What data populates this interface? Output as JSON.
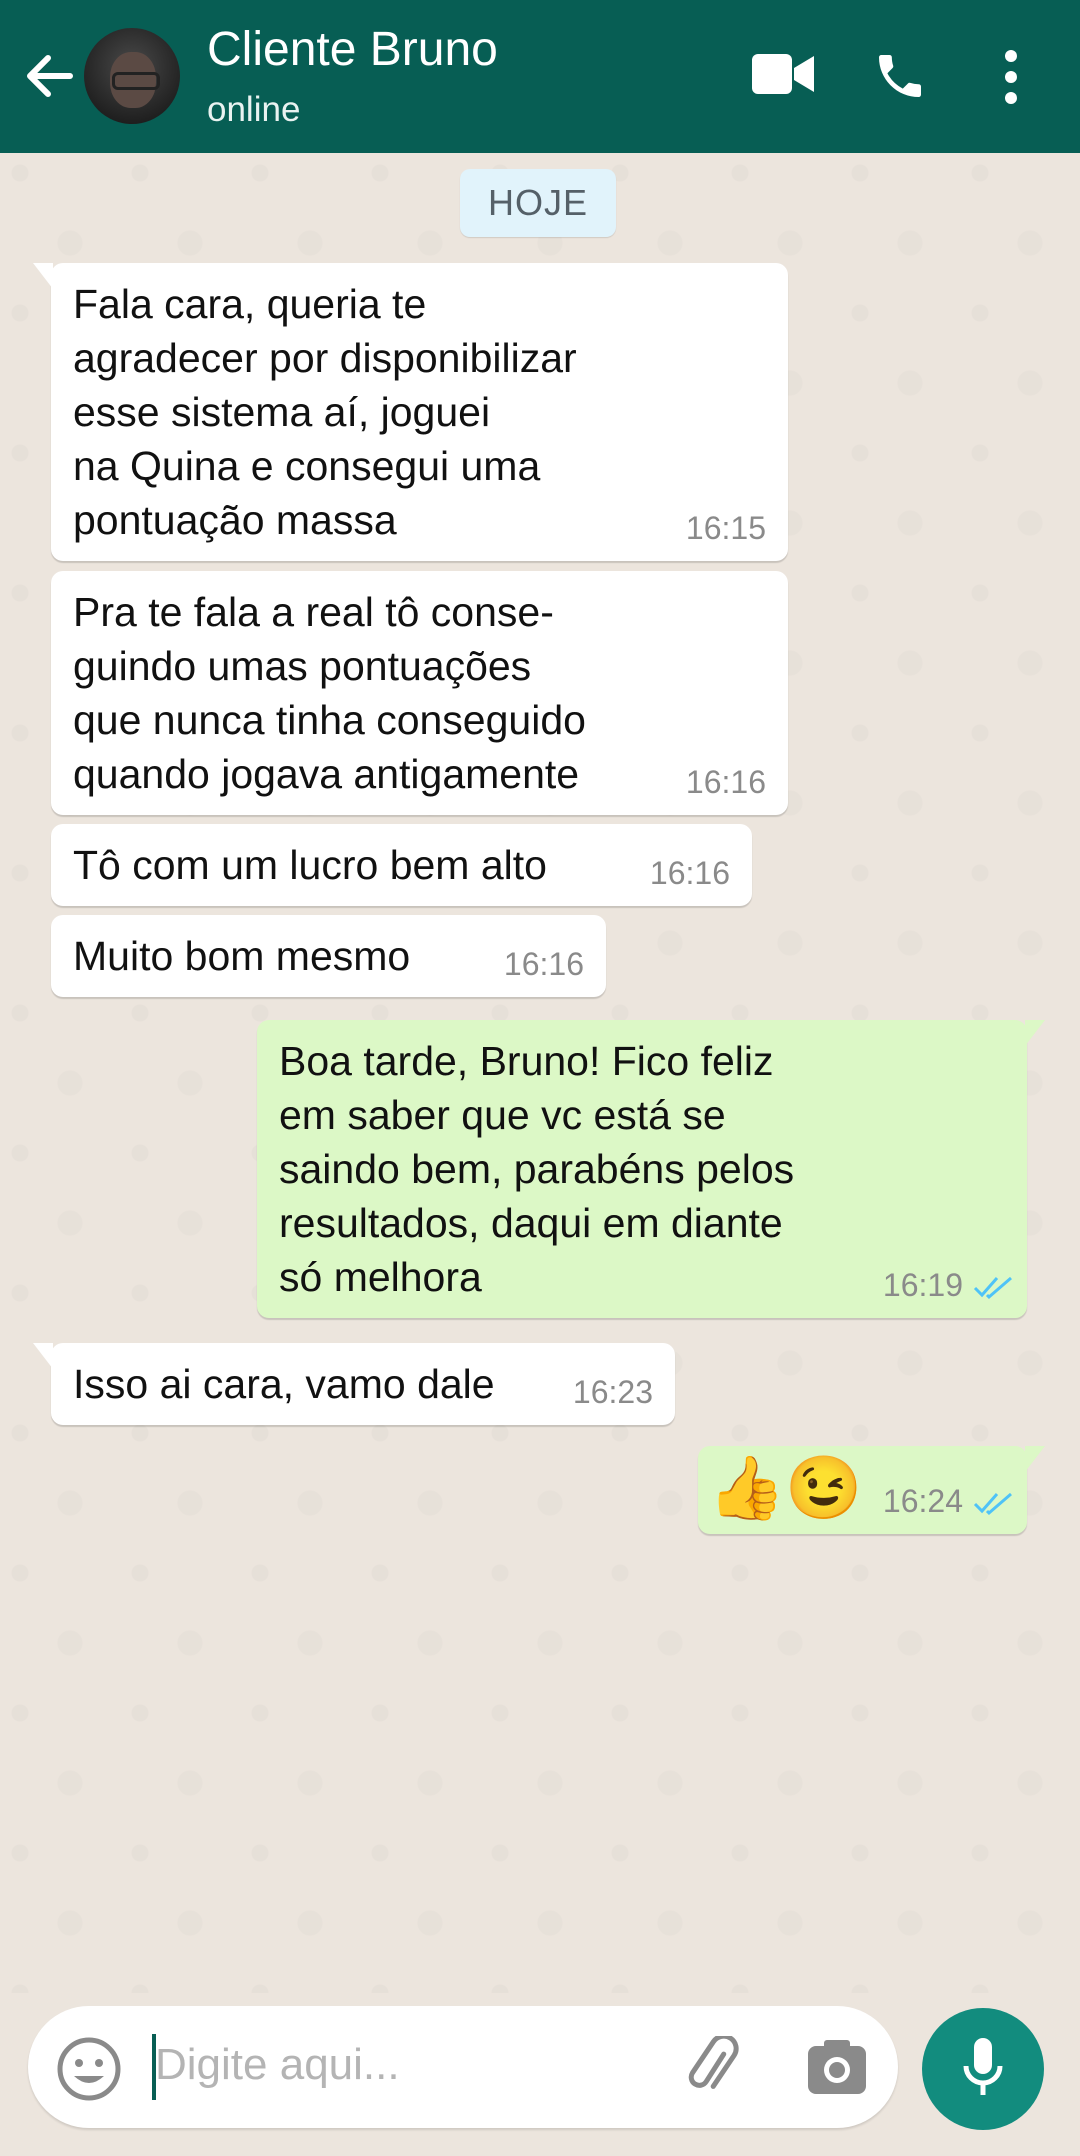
{
  "header": {
    "back_icon": "arrow-left-icon",
    "contact_name": "Cliente Bruno",
    "status": "online",
    "video_icon": "video-camera-icon",
    "call_icon": "phone-icon",
    "menu_icon": "more-vertical-icon",
    "color": "#075e54"
  },
  "chat": {
    "date_divider": "HOJE",
    "messages": [
      {
        "direction": "in",
        "text": "Fala cara, queria te\nagradecer por disponibilizar\nesse sistema aí, joguei\nna Quina e consegui uma\npontuação massa",
        "time": "16:15"
      },
      {
        "direction": "in",
        "text": "Pra te fala a real tô conse-\nguindo umas pontuações\nque nunca tinha conseguido\nquando jogava antigamente",
        "time": "16:16"
      },
      {
        "direction": "in",
        "text": "Tô com um lucro bem alto",
        "time": "16:16"
      },
      {
        "direction": "in",
        "text": "Muito bom mesmo",
        "time": "16:16"
      },
      {
        "direction": "out",
        "text": "Boa tarde, Bruno! Fico feliz\nem saber que vc está se\nsaindo bem, parabéns pelos\nresultados, daqui em diante\nsó melhora",
        "time": "16:19",
        "status": "read"
      },
      {
        "direction": "in",
        "text": "Isso ai cara, vamo dale",
        "time": "16:23"
      },
      {
        "direction": "out",
        "text": "👍😉",
        "time": "16:24",
        "status": "read"
      }
    ],
    "incoming_color": "#ffffff",
    "outgoing_color": "#dcf8c6",
    "read_tick_color": "#4fc3f7"
  },
  "composer": {
    "emoji_icon": "smiley-icon",
    "placeholder": "Digite aqui...",
    "attach_icon": "paperclip-icon",
    "camera_icon": "camera-icon",
    "mic_icon": "microphone-icon"
  }
}
